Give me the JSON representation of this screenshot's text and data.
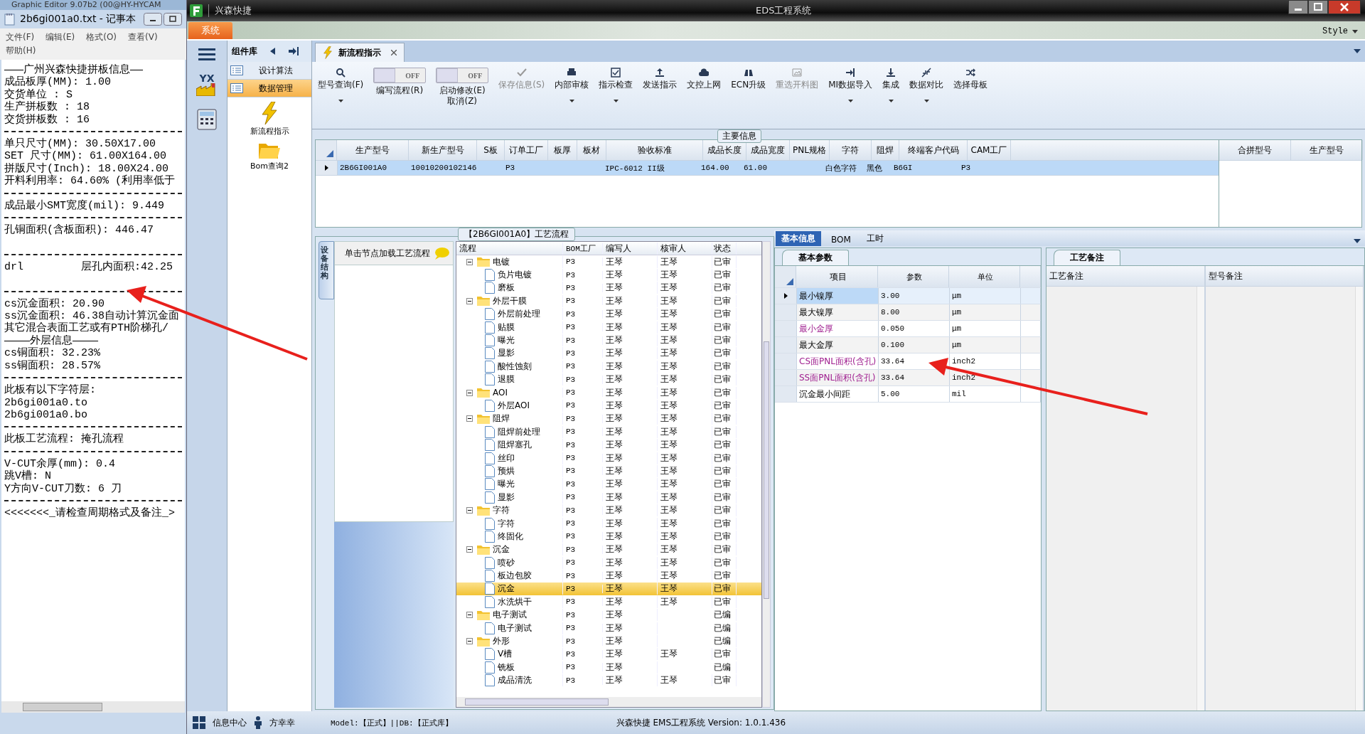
{
  "background_window": {
    "title": "Graphic Editor 9.07b2 (00@HY-HYCAM"
  },
  "notepad": {
    "title": "2b6gi001a0.txt - 记事本",
    "menu": [
      "文件(F)",
      "编辑(E)",
      "格式(O)",
      "查看(V)",
      "帮助(H)"
    ],
    "lines": [
      {
        "kind": "text",
        "text": "———广州兴森快捷拼板信息——"
      },
      {
        "kind": "text",
        "text": "成品板厚(MM): 1.00"
      },
      {
        "kind": "text",
        "text": "交货单位 : S"
      },
      {
        "kind": "text",
        "text": "生产拼板数 : 18"
      },
      {
        "kind": "text",
        "text": "交货拼板数 : 16"
      },
      {
        "kind": "rule"
      },
      {
        "kind": "text",
        "text": "单只尺寸(MM): 30.50X17.00"
      },
      {
        "kind": "text",
        "text": "SET 尺寸(MM): 61.00X164.00"
      },
      {
        "kind": "text",
        "text": "拼版尺寸(Inch): 18.00X24.00"
      },
      {
        "kind": "text",
        "text": "开料利用率: 64.60% (利用率低于"
      },
      {
        "kind": "rule"
      },
      {
        "kind": "text",
        "text": "成品最小SMT宽度(mil): 9.449"
      },
      {
        "kind": "rule"
      },
      {
        "kind": "text",
        "text": "孔铜面积(含板面积): 446.47"
      },
      {
        "kind": "blank"
      },
      {
        "kind": "rule"
      },
      {
        "kind": "text",
        "text": "drl         层孔内面积:42.25"
      },
      {
        "kind": "blank"
      },
      {
        "kind": "rule"
      },
      {
        "kind": "text",
        "text": "cs沉金面积: 20.90"
      },
      {
        "kind": "text",
        "text": "ss沉金面积: 46.38自动计算沉金面"
      },
      {
        "kind": "text",
        "text": "其它混合表面工艺或有PTH阶梯孔/"
      },
      {
        "kind": "text",
        "text": "————外层信息————"
      },
      {
        "kind": "text",
        "text": "cs铜面积: 32.23%"
      },
      {
        "kind": "text",
        "text": "ss铜面积: 28.57%"
      },
      {
        "kind": "rule"
      },
      {
        "kind": "text",
        "text": "此板有以下字符层:"
      },
      {
        "kind": "text",
        "text": "2b6gi001a0.to"
      },
      {
        "kind": "text",
        "text": "2b6gi001a0.bo"
      },
      {
        "kind": "rule"
      },
      {
        "kind": "text",
        "text": "此板工艺流程: 掩孔流程"
      },
      {
        "kind": "rule"
      },
      {
        "kind": "text",
        "text": "V-CUT余厚(mm): 0.4"
      },
      {
        "kind": "text",
        "text": "跳V槽: N"
      },
      {
        "kind": "text",
        "text": "Y方向V-CUT刀数: 6 刀"
      },
      {
        "kind": "rule"
      },
      {
        "kind": "text",
        "text": "<<<<<<<_请检查周期格式及备注_>"
      }
    ]
  },
  "app": {
    "name": "兴森快捷",
    "title": "EDS工程系统",
    "menu_tab": "系统",
    "style_menu": "Style"
  },
  "icon_strip": {
    "logo_text": "YX"
  },
  "component_library": {
    "title": "组件库",
    "items": [
      {
        "label": "设计算法",
        "selected": false
      },
      {
        "label": "数据管理",
        "selected": true
      }
    ],
    "tiles": [
      {
        "label": "新流程指示"
      },
      {
        "label": "Bom查询2"
      }
    ]
  },
  "document_tabs": [
    {
      "label": "新流程指示",
      "selected": true
    }
  ],
  "toolbar": [
    {
      "kind": "button",
      "label": "型号查询(F)",
      "dropdown": true,
      "disabled": false
    },
    {
      "kind": "toggle",
      "label": "编写流程(R)",
      "state_label": "OFF",
      "on": false
    },
    {
      "kind": "toggle",
      "label": "启动修改(E)\n取消(Z)",
      "state_label": "OFF",
      "on": false
    },
    {
      "kind": "button",
      "label": "保存信息(S)",
      "dropdown": false,
      "disabled": true
    },
    {
      "kind": "button",
      "label": "内部审核",
      "dropdown": true,
      "disabled": false
    },
    {
      "kind": "button",
      "label": "指示检查",
      "dropdown": true,
      "disabled": false
    },
    {
      "kind": "button",
      "label": "发送指示",
      "dropdown": false,
      "disabled": false
    },
    {
      "kind": "button",
      "label": "文控上网",
      "dropdown": false,
      "disabled": false
    },
    {
      "kind": "button",
      "label": "ECN升级",
      "dropdown": false,
      "disabled": false
    },
    {
      "kind": "button",
      "label": "重选开料图",
      "dropdown": false,
      "disabled": true
    },
    {
      "kind": "button",
      "label": "MI数据导入",
      "dropdown": true,
      "disabled": false
    },
    {
      "kind": "button",
      "label": "集成",
      "dropdown": true,
      "disabled": false
    },
    {
      "kind": "button",
      "label": "数据对比",
      "dropdown": true,
      "disabled": false
    },
    {
      "kind": "button",
      "label": "选择母板",
      "dropdown": false,
      "disabled": false
    }
  ],
  "main_info": {
    "title": "主要信息",
    "columns": [
      "生产型号",
      "新生产型号",
      "S板",
      "订单工厂",
      "板厚",
      "板材",
      "验收标准",
      "成品长度",
      "成品宽度",
      "PNL规格",
      "字符",
      "阻焊",
      "终端客户代码",
      "CAM工厂"
    ],
    "rows": [
      {
        "selected": true,
        "cells": [
          "2B6GI001A0",
          "10010200102146",
          null,
          "P3",
          null,
          null,
          "IPC-6012 II级",
          "164.00",
          "61.00",
          null,
          "白色字符",
          "黑色",
          "B6GI",
          "P3"
        ]
      }
    ],
    "side_columns": [
      "合拼型号",
      "生产型号"
    ]
  },
  "process_flow": {
    "title": "【2B6GI001A0】工艺流程",
    "side_tab": "设备结构",
    "hint": "单击节点加载工艺流程",
    "columns": [
      "流程",
      "BOM工厂",
      "编写人",
      "核审人",
      "状态"
    ],
    "nodes": [
      {
        "name": "电镀",
        "bom_factory": "P3",
        "author": "王琴",
        "reviewer": "王琴",
        "status": "已审",
        "expanded": true,
        "selected": false,
        "children": [
          {
            "name": "负片电镀",
            "bom_factory": "P3",
            "author": "王琴",
            "reviewer": "王琴",
            "status": "已审",
            "selected": false
          },
          {
            "name": "磨板",
            "bom_factory": "P3",
            "author": "王琴",
            "reviewer": "王琴",
            "status": "已审",
            "selected": false
          }
        ]
      },
      {
        "name": "外层干膜",
        "bom_factory": "P3",
        "author": "王琴",
        "reviewer": "王琴",
        "status": "已审",
        "expanded": true,
        "selected": false,
        "children": [
          {
            "name": "外层前处理",
            "bom_factory": "P3",
            "author": "王琴",
            "reviewer": "王琴",
            "status": "已审",
            "selected": false
          },
          {
            "name": "贴膜",
            "bom_factory": "P3",
            "author": "王琴",
            "reviewer": "王琴",
            "status": "已审",
            "selected": false
          },
          {
            "name": "曝光",
            "bom_factory": "P3",
            "author": "王琴",
            "reviewer": "王琴",
            "status": "已审",
            "selected": false
          },
          {
            "name": "显影",
            "bom_factory": "P3",
            "author": "王琴",
            "reviewer": "王琴",
            "status": "已审",
            "selected": false
          },
          {
            "name": "酸性蚀刻",
            "bom_factory": "P3",
            "author": "王琴",
            "reviewer": "王琴",
            "status": "已审",
            "selected": false
          },
          {
            "name": "退膜",
            "bom_factory": "P3",
            "author": "王琴",
            "reviewer": "王琴",
            "status": "已审",
            "selected": false
          }
        ]
      },
      {
        "name": "AOI",
        "bom_factory": "P3",
        "author": "王琴",
        "reviewer": "王琴",
        "status": "已审",
        "expanded": true,
        "selected": false,
        "children": [
          {
            "name": "外层AOI",
            "bom_factory": "P3",
            "author": "王琴",
            "reviewer": "王琴",
            "status": "已审",
            "selected": false
          }
        ]
      },
      {
        "name": "阻焊",
        "bom_factory": "P3",
        "author": "王琴",
        "reviewer": "王琴",
        "status": "已审",
        "expanded": true,
        "selected": false,
        "children": [
          {
            "name": "阻焊前处理",
            "bom_factory": "P3",
            "author": "王琴",
            "reviewer": "王琴",
            "status": "已审",
            "selected": false
          },
          {
            "name": "阻焊塞孔",
            "bom_factory": "P3",
            "author": "王琴",
            "reviewer": "王琴",
            "status": "已审",
            "selected": false
          },
          {
            "name": "丝印",
            "bom_factory": "P3",
            "author": "王琴",
            "reviewer": "王琴",
            "status": "已审",
            "selected": false
          },
          {
            "name": "预烘",
            "bom_factory": "P3",
            "author": "王琴",
            "reviewer": "王琴",
            "status": "已审",
            "selected": false
          },
          {
            "name": "曝光",
            "bom_factory": "P3",
            "author": "王琴",
            "reviewer": "王琴",
            "status": "已审",
            "selected": false
          },
          {
            "name": "显影",
            "bom_factory": "P3",
            "author": "王琴",
            "reviewer": "王琴",
            "status": "已审",
            "selected": false
          }
        ]
      },
      {
        "name": "字符",
        "bom_factory": "P3",
        "author": "王琴",
        "reviewer": "王琴",
        "status": "已审",
        "expanded": true,
        "selected": false,
        "children": [
          {
            "name": "字符",
            "bom_factory": "P3",
            "author": "王琴",
            "reviewer": "王琴",
            "status": "已审",
            "selected": false
          },
          {
            "name": "终固化",
            "bom_factory": "P3",
            "author": "王琴",
            "reviewer": "王琴",
            "status": "已审",
            "selected": false
          }
        ]
      },
      {
        "name": "沉金",
        "bom_factory": "P3",
        "author": "王琴",
        "reviewer": "王琴",
        "status": "已审",
        "expanded": true,
        "selected": false,
        "children": [
          {
            "name": "喷砂",
            "bom_factory": "P3",
            "author": "王琴",
            "reviewer": "王琴",
            "status": "已审",
            "selected": false
          },
          {
            "name": "板边包胶",
            "bom_factory": "P3",
            "author": "王琴",
            "reviewer": "王琴",
            "status": "已审",
            "selected": false
          },
          {
            "name": "沉金",
            "bom_factory": "P3",
            "author": "王琴",
            "reviewer": "王琴",
            "status": "已审",
            "selected": true
          },
          {
            "name": "水洗烘干",
            "bom_factory": "P3",
            "author": "王琴",
            "reviewer": "王琴",
            "status": "已审",
            "selected": false
          }
        ]
      },
      {
        "name": "电子测试",
        "bom_factory": "P3",
        "author": "王琴",
        "status": "已编",
        "expanded": true,
        "selected": false,
        "children": [
          {
            "name": "电子测试",
            "bom_factory": "P3",
            "author": "王琴",
            "status": "已编",
            "selected": false
          }
        ]
      },
      {
        "name": "外形",
        "bom_factory": "P3",
        "author": "王琴",
        "status": "已编",
        "expanded": true,
        "selected": false,
        "children": [
          {
            "name": "V槽",
            "bom_factory": "P3",
            "author": "王琴",
            "reviewer": "王琴",
            "status": "已审",
            "selected": false
          },
          {
            "name": "铣板",
            "bom_factory": "P3",
            "author": "王琴",
            "status": "已编",
            "selected": false
          },
          {
            "name": "成品清洗",
            "bom_factory": "P3",
            "author": "王琴",
            "reviewer": "王琴",
            "status": "已审",
            "selected": false
          }
        ]
      }
    ]
  },
  "detail_tabs": [
    {
      "label": "基本信息",
      "selected": true
    },
    {
      "label": "BOM",
      "selected": false
    },
    {
      "label": "工时",
      "selected": false
    }
  ],
  "basic_params": {
    "tab": "基本参数",
    "columns": [
      "项目",
      "参数",
      "单位"
    ],
    "rows": [
      {
        "item": "最小镍厚",
        "value": "3.00",
        "unit": "μm",
        "highlighted": false,
        "selected": true
      },
      {
        "item": "最大镍厚",
        "value": "8.00",
        "unit": "μm",
        "highlighted": false,
        "selected": false
      },
      {
        "item": "最小金厚",
        "value": "0.050",
        "unit": "μm",
        "highlighted": true,
        "selected": false
      },
      {
        "item": "最大金厚",
        "value": "0.100",
        "unit": "μm",
        "highlighted": false,
        "selected": false
      },
      {
        "item": "CS面PNL面积(含孔)",
        "value": "33.64",
        "unit": "inch2",
        "highlighted": true,
        "selected": false
      },
      {
        "item": "SS面PNL面积(含孔)",
        "value": "33.64",
        "unit": "inch2",
        "highlighted": true,
        "selected": false
      },
      {
        "item": "沉金最小间距",
        "value": "5.00",
        "unit": "mil",
        "highlighted": false,
        "selected": false
      }
    ]
  },
  "remarks": {
    "tab": "工艺备注",
    "columns": [
      "工艺备注",
      "型号备注"
    ]
  },
  "status_bar": {
    "items": [
      "信息中心",
      "方幸幸"
    ],
    "model": "Model:【正式】||DB:【正式库】",
    "version": "兴森快捷 EMS工程系统 Version: 1.0.1.436"
  }
}
